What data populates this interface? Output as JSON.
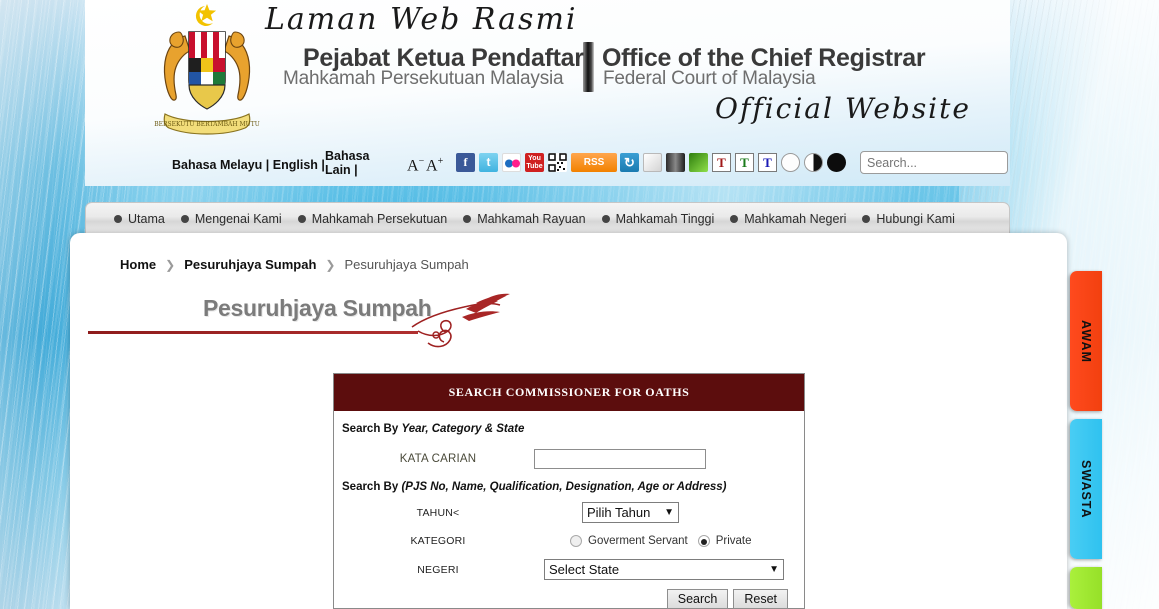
{
  "banner": {
    "script_top": "Laman Web Rasmi",
    "script_bottom": "Official Website",
    "title_ms_line1": "Pejabat Ketua Pendaftar",
    "title_ms_line2": "Mahkamah Persekutuan Malaysia",
    "title_en_line1": "Office of the Chief Registrar",
    "title_en_line2": "Federal Court of Malaysia",
    "crest_name": "malaysia-coat-of-arms"
  },
  "utilbar": {
    "languages": "Bahasa Melayu | English |",
    "lang_other": "Bahasa Lain |",
    "font_decrease": "A",
    "font_decrease_sup": "−",
    "font_increase": "A",
    "font_increase_sup": "+",
    "icons": [
      {
        "name": "facebook-icon",
        "glyph": "f"
      },
      {
        "name": "twitter-icon",
        "glyph": "t"
      },
      {
        "name": "flickr-icon",
        "glyph": "●●"
      },
      {
        "name": "youtube-icon",
        "glyph": "You Tube"
      },
      {
        "name": "qr-code-icon",
        "glyph": "░▒"
      },
      {
        "name": "rss-icon",
        "glyph": "RSS"
      },
      {
        "name": "reset-layout-icon",
        "glyph": "↺"
      },
      {
        "name": "theme-white-icon",
        "glyph": ""
      },
      {
        "name": "theme-dark-icon",
        "glyph": ""
      },
      {
        "name": "theme-green-icon",
        "glyph": ""
      },
      {
        "name": "text-size-red-icon",
        "glyph": "T"
      },
      {
        "name": "text-size-green-icon",
        "glyph": "T"
      },
      {
        "name": "text-size-blue-icon",
        "glyph": "T"
      },
      {
        "name": "contrast-normal-icon",
        "glyph": ""
      },
      {
        "name": "contrast-half-icon",
        "glyph": ""
      },
      {
        "name": "contrast-high-icon",
        "glyph": ""
      }
    ],
    "search_placeholder": "Search..."
  },
  "nav": {
    "items": [
      {
        "label": "Utama"
      },
      {
        "label": "Mengenai Kami"
      },
      {
        "label": "Mahkamah Persekutuan"
      },
      {
        "label": "Mahkamah Rayuan"
      },
      {
        "label": "Mahkamah Tinggi"
      },
      {
        "label": "Mahkamah Negeri"
      },
      {
        "label": "Hubungi Kami"
      }
    ]
  },
  "breadcrumb": {
    "home": "Home",
    "level1": "Pesuruhjaya Sumpah",
    "level2": "Pesuruhjaya Sumpah",
    "separator": "❯"
  },
  "page": {
    "title": "Pesuruhjaya Sumpah"
  },
  "panel": {
    "heading": "SEARCH COMMISSIONER FOR OATHS",
    "search_by_1_prefix": "Search By ",
    "search_by_1_em": "Year, Category & State",
    "search_by_2_prefix": "Search By ",
    "search_by_2_em": "(PJS No, Name, Qualification, Designation, Age or Address)",
    "kata_carian_label": "KATA CARIAN",
    "kata_carian_value": "",
    "tahun_label": "TAHUN<",
    "tahun_value": "Pilih Tahun",
    "kategori_label": "KATEGORI",
    "kategori_option_1": "Goverment Servant",
    "kategori_option_2": "Private",
    "kategori_selected": "Private",
    "negeri_label": "NEGERI",
    "negeri_value": "Select State",
    "search_button": "Search",
    "reset_button": "Reset",
    "header_color": "#5c0d0d"
  },
  "sidetabs": [
    {
      "label": "AWAM",
      "color": "#ff4a1e"
    },
    {
      "label": "SWASTA",
      "color": "#49cdf4"
    },
    {
      "label": "",
      "color": "#aaf03c"
    }
  ]
}
